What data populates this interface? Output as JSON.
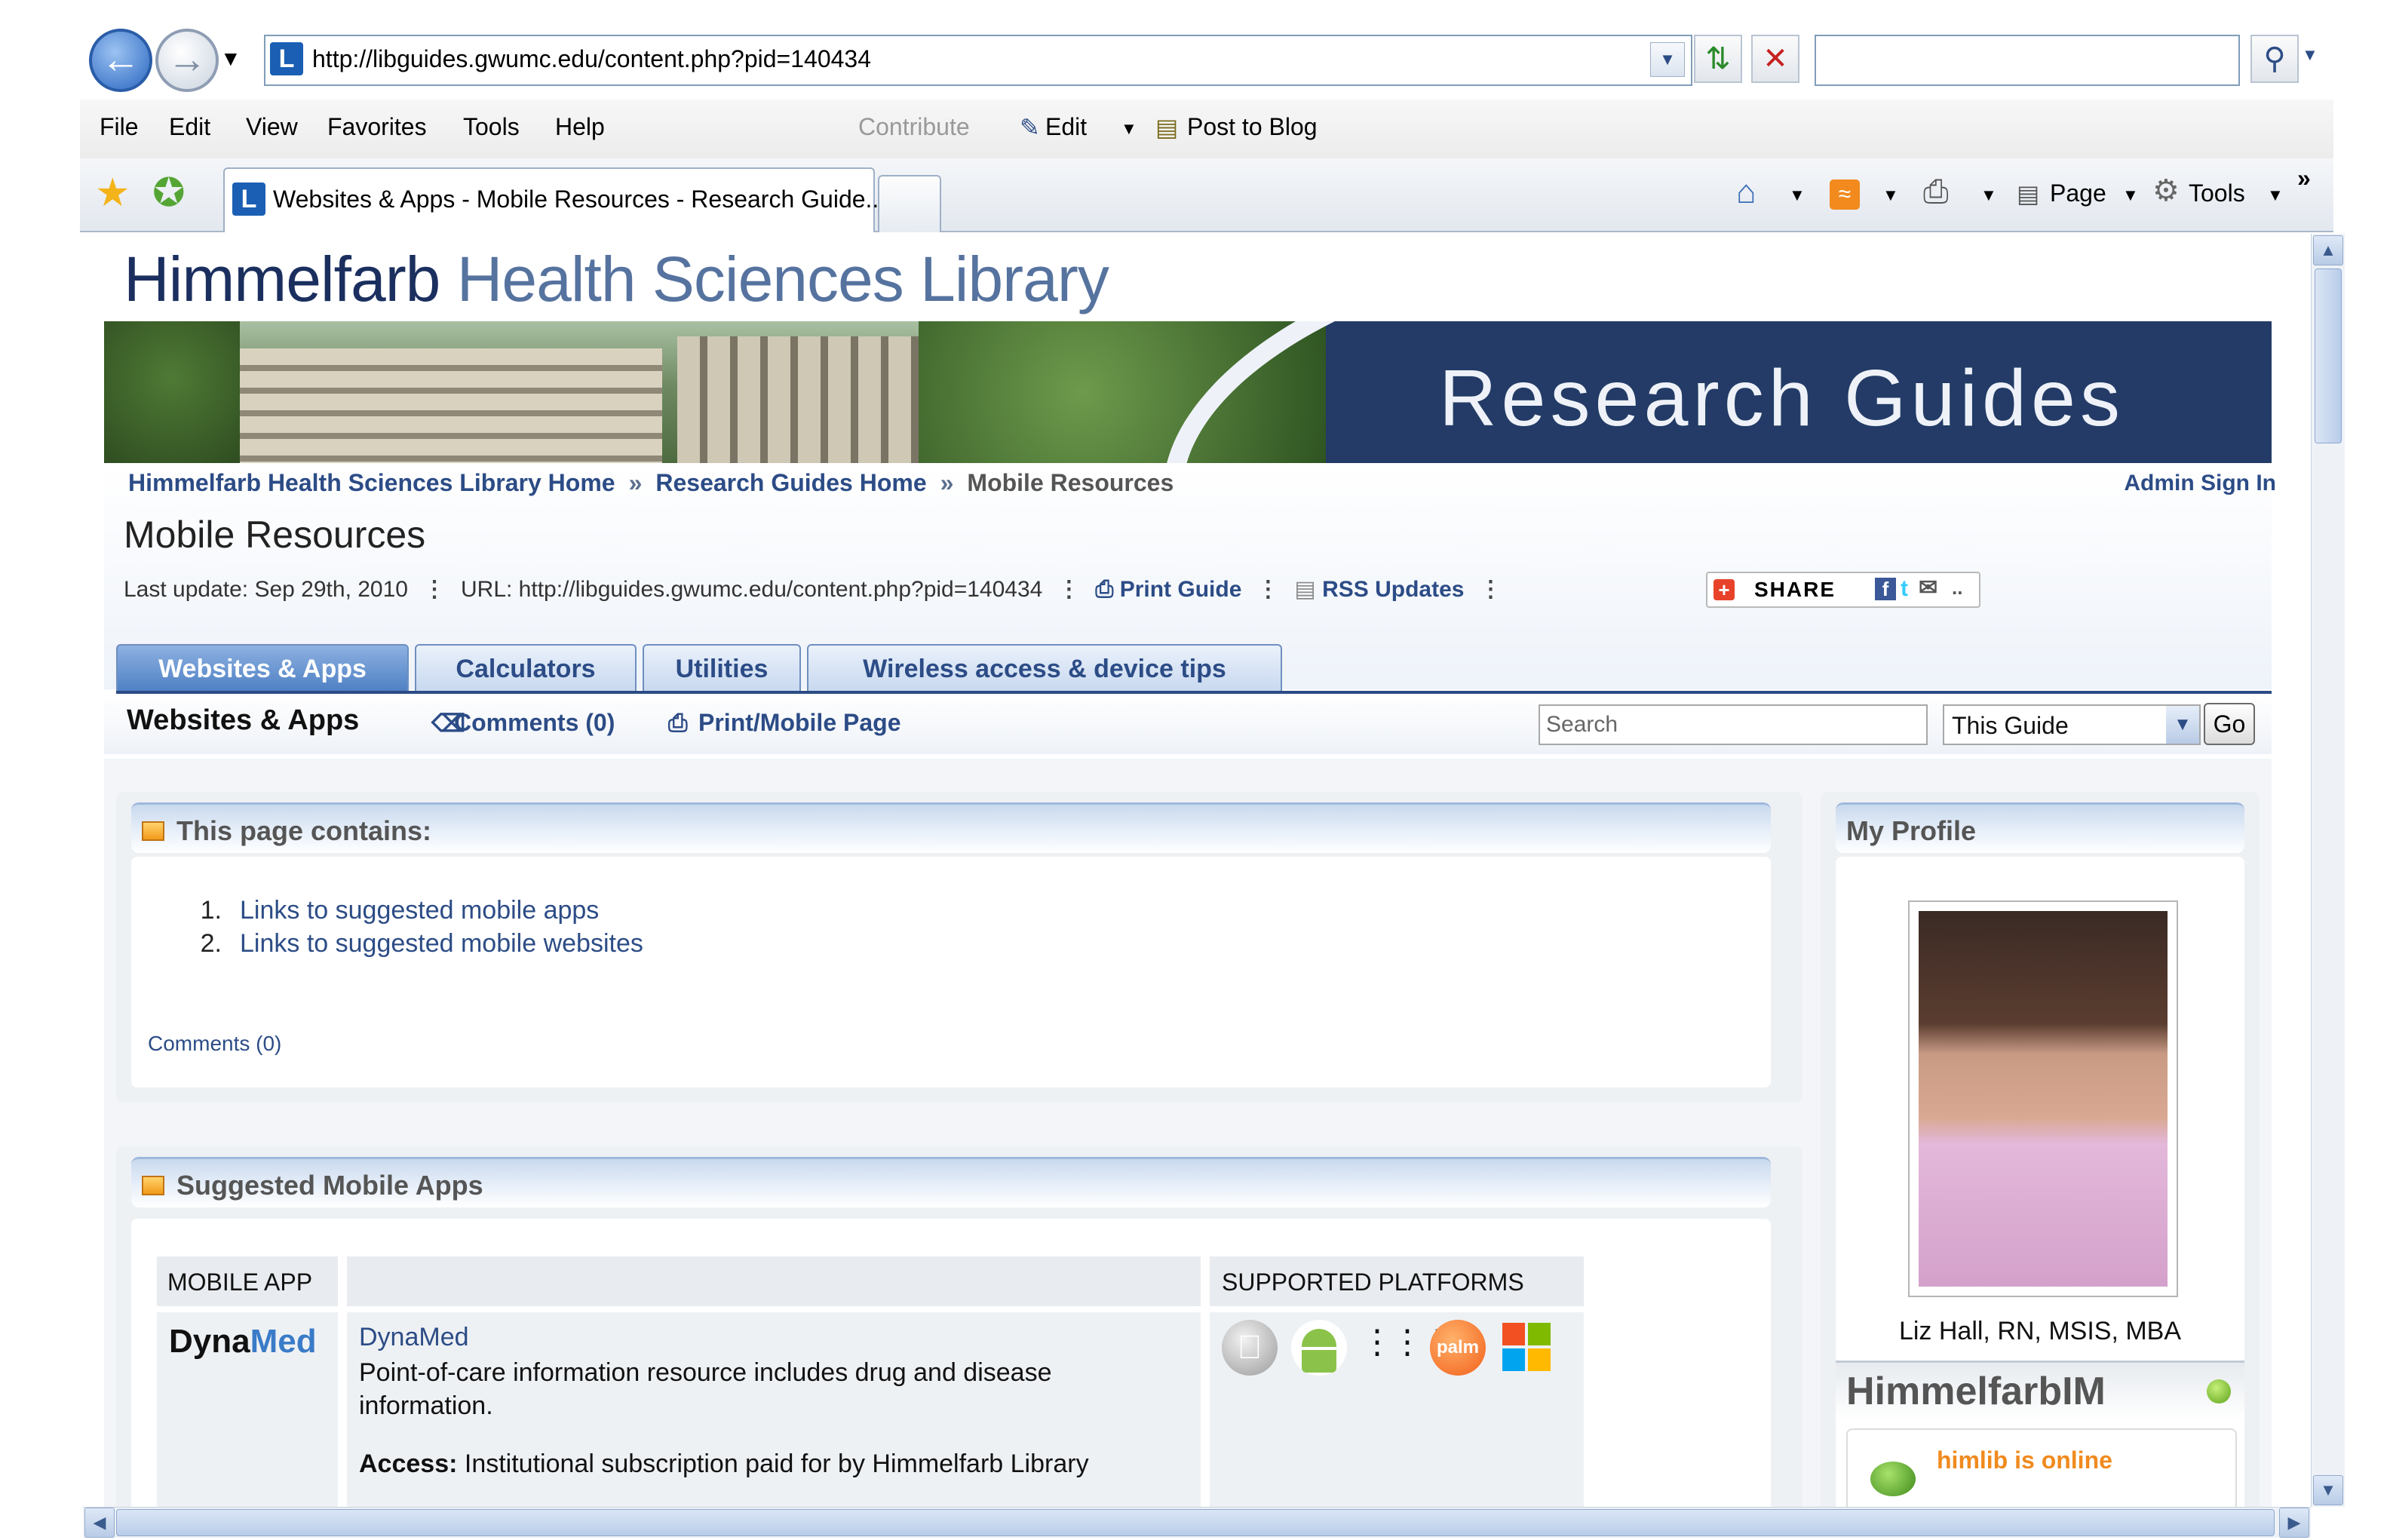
{
  "browser": {
    "url": "http://libguides.gwumc.edu/content.php?pid=140434",
    "search_placeholder": "",
    "menu": [
      "File",
      "Edit",
      "View",
      "Favorites",
      "Tools",
      "Help"
    ],
    "contribute": "Contribute",
    "edit": "Edit",
    "post_to_blog": "Post to Blog",
    "tab_title": "Websites & Apps - Mobile Resources - Research Guide...",
    "tools": {
      "page": "Page",
      "tools": "Tools"
    }
  },
  "header": {
    "title_dark": "Himmelfarb",
    "title_light": "Health Sciences Library",
    "hero_text": "Research Guides"
  },
  "breadcrumb": {
    "home": "Himmelfarb Health Sciences Library Home",
    "sep": "»",
    "guides": "Research Guides Home",
    "current": "Mobile Resources",
    "admin": "Admin Sign In"
  },
  "guide": {
    "title": "Mobile Resources",
    "last_update": "Last update: Sep 29th, 2010",
    "url": "URL: http://libguides.gwumc.edu/content.php?pid=140434",
    "print": "Print Guide",
    "rss": "RSS Updates",
    "share": "SHARE"
  },
  "tabs": [
    "Websites & Apps",
    "Calculators",
    "Utilities",
    "Wireless access & device tips"
  ],
  "page": {
    "subtitle": "Websites & Apps",
    "comments": "Comments (0)",
    "print_mobile": "Print/Mobile Page",
    "search_placeholder": "Search",
    "scope": "This Guide",
    "go": "Go"
  },
  "contains": {
    "title": "This page contains:",
    "items": [
      {
        "n": "1.",
        "label": "Links to suggested mobile apps"
      },
      {
        "n": "2.",
        "label": "Links to suggested mobile websites"
      }
    ],
    "comments": "Comments (0)"
  },
  "apps": {
    "title": "Suggested Mobile Apps",
    "col_app": "MOBILE APP",
    "col_desc": "",
    "col_platforms": "SUPPORTED PLATFORMS",
    "row": {
      "logo_a": "Dyna",
      "logo_b": "Med",
      "name": "DynaMed",
      "desc": "Point-of-care information resource includes drug and disease information.",
      "access_label": "Access:",
      "access_text": "Institutional subscription paid for by Himmelfarb Library",
      "platforms": [
        "apple-icon",
        "android-icon",
        "blackberry-icon",
        "palm-icon",
        "windows-icon"
      ],
      "palm_label": "palm"
    }
  },
  "profile": {
    "title": "My Profile",
    "name": "Liz Hall, RN, MSIS, MBA",
    "im_title": "HimmelfarbIM",
    "im_status": "himlib is online"
  }
}
